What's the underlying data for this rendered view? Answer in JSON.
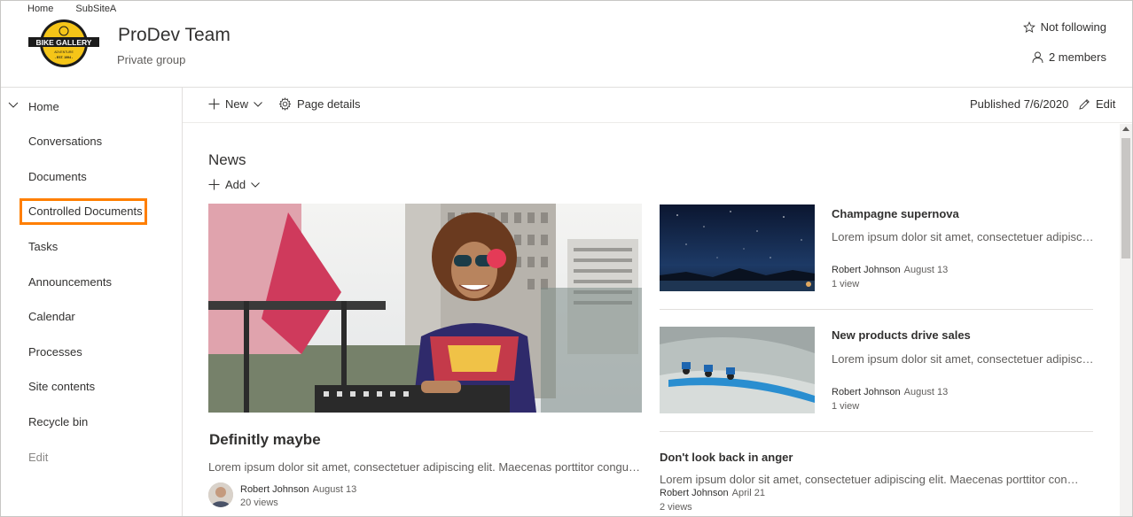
{
  "suite_nav": [
    "Home",
    "SubSiteA"
  ],
  "logo": {
    "text": "BIKE GALLERY",
    "subtext": "ADVENTURE",
    "est": "- EST. 1994 -"
  },
  "site": {
    "title": "ProDev Team",
    "subtitle": "Private group"
  },
  "header_actions": {
    "follow": "Not following",
    "members": "2 members"
  },
  "leftnav": {
    "items": [
      "Home",
      "Conversations",
      "Documents",
      "Controlled Documents",
      "Tasks",
      "Announcements",
      "Calendar",
      "Processes",
      "Site contents",
      "Recycle bin"
    ],
    "edit": "Edit"
  },
  "command_bar": {
    "new": "New",
    "page_details": "Page details",
    "published": "Published 7/6/2020",
    "edit": "Edit"
  },
  "news": {
    "title": "News",
    "add": "Add",
    "hero": {
      "title": "Definitly maybe",
      "desc": "Lorem ipsum dolor sit amet, consectetuer adipiscing elit. Maecenas porttitor congue massa.",
      "author": "Robert Johnson",
      "date": "August 13",
      "views": "20 views"
    },
    "cards": [
      {
        "title": "Champagne supernova",
        "desc": "Lorem ipsum dolor sit amet, consectetuer adipiscing elit.",
        "author": "Robert Johnson",
        "date": "August 13",
        "views": "1 view"
      },
      {
        "title": "New products drive sales",
        "desc": "Lorem ipsum dolor sit amet, consectetuer adipiscing elit.",
        "author": "Robert Johnson",
        "date": "August 13",
        "views": "1 view"
      }
    ],
    "text_item": {
      "title": "Don't look back in anger",
      "desc": "Lorem ipsum dolor sit amet, consectetuer adipiscing elit. Maecenas porttitor congue massa.",
      "author": "Robert Johnson",
      "date": "April 21",
      "views": "2 views"
    }
  },
  "colors": {
    "highlight": "#ff7f00",
    "logo_yellow": "#f5c518",
    "logo_black": "#1b1b1b"
  },
  "icons": [
    "star-icon",
    "person-icon",
    "chevron-down-icon",
    "plus-icon",
    "gear-icon",
    "pencil-icon"
  ]
}
